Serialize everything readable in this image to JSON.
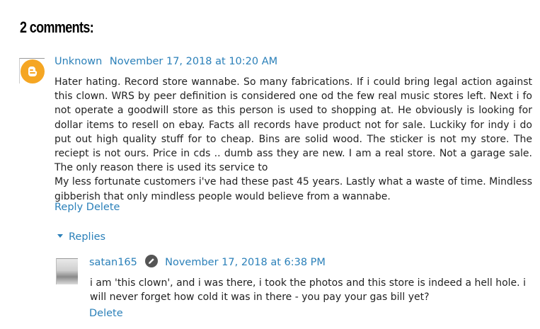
{
  "section": {
    "heading": "2 comments:"
  },
  "comment": {
    "author": "Unknown",
    "timestamp": "November 17, 2018 at 10:20 AM",
    "body_lines": [
      "Hater hating. Record store wannabe. So many fabrications. If i could bring legal action against this clown. WRS by peer definition is considered one od the few real music stores left. Next i fo not operate a goodwill store as this person is used to shopping at. He obviously is looking for dollar items to resell on ebay. Facts all records have product not for sale. Luckiky for indy i do put out high quality stuff for to cheap. Bins are solid wood. The sticker is not my store. The reciept is not ours. Price in cds .. dumb ass they are new. I am a real store. Not a garage sale. The only reason there is used its service to",
      "My less fortunate customers i've had these past 45 years. Lastly what a waste of time. Mindless gibberish that only mindless people would believe from a wannabe."
    ],
    "reply_label": "Reply",
    "delete_label": "Delete",
    "avatar_icon": "blogger-icon",
    "avatar_color": "#f5a623"
  },
  "replies": {
    "toggle_label": "Replies",
    "toggle_icon": "triangle-down-icon",
    "items": [
      {
        "author": "satan165",
        "badge_icon": "pencil-icon",
        "timestamp": "November 17, 2018 at 6:38 PM",
        "body": "i am 'this clown', and i was there, i took the photos and this store is indeed a hell hole. i will never forget how cold it was in there - you pay your gas bill yet?",
        "delete_label": "Delete"
      }
    ]
  },
  "colors": {
    "link": "#2b80b9",
    "text": "#222222"
  }
}
